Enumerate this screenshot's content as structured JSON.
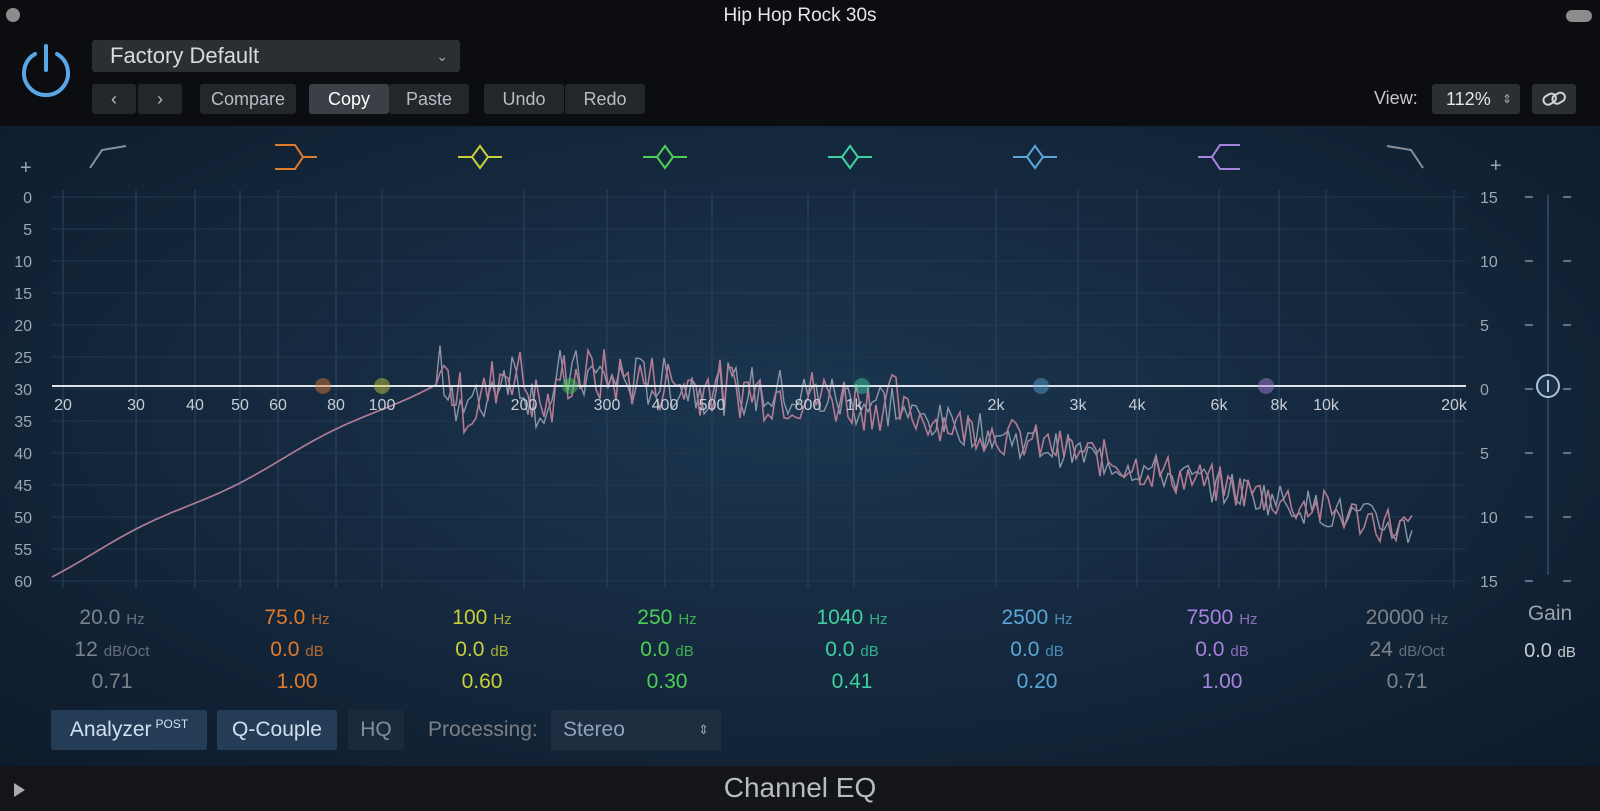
{
  "window": {
    "title": "Hip Hop Rock 30s"
  },
  "header": {
    "preset": "Factory Default",
    "buttons": {
      "prev": "‹",
      "next": "›",
      "compare": "Compare",
      "copy": "Copy",
      "paste": "Paste",
      "undo": "Undo",
      "redo": "Redo"
    },
    "view_label": "View:",
    "view_value": "112%"
  },
  "graph": {
    "left_scale": [
      "0",
      "5",
      "10",
      "15",
      "20",
      "25",
      "30",
      "35",
      "40",
      "45",
      "50",
      "55",
      "60"
    ],
    "right_scale": [
      "15",
      "10",
      "5",
      "0",
      "5",
      "10",
      "15"
    ],
    "freq_labels": [
      "20",
      "30",
      "40",
      "50",
      "60",
      "80",
      "100",
      "200",
      "300",
      "400",
      "500",
      "800",
      "1k",
      "2k",
      "3k",
      "4k",
      "6k",
      "8k",
      "10k",
      "20k"
    ],
    "plus_left": "+",
    "plus_right": "+"
  },
  "bands": [
    {
      "freq": "20.0",
      "freq_unit": "Hz",
      "gain": "12",
      "gain_unit": "dB/Oct",
      "q": "0.71",
      "color": "#8a8f98"
    },
    {
      "freq": "75.0",
      "freq_unit": "Hz",
      "gain": "0.0",
      "gain_unit": "dB",
      "q": "1.00",
      "color": "#e07b2c"
    },
    {
      "freq": "100",
      "freq_unit": "Hz",
      "gain": "0.0",
      "gain_unit": "dB",
      "q": "0.60",
      "color": "#c9cf37"
    },
    {
      "freq": "250",
      "freq_unit": "Hz",
      "gain": "0.0",
      "gain_unit": "dB",
      "q": "0.30",
      "color": "#4ccf55"
    },
    {
      "freq": "1040",
      "freq_unit": "Hz",
      "gain": "0.0",
      "gain_unit": "dB",
      "q": "0.41",
      "color": "#3fd0a0"
    },
    {
      "freq": "2500",
      "freq_unit": "Hz",
      "gain": "0.0",
      "gain_unit": "dB",
      "q": "0.20",
      "color": "#5aa6d6"
    },
    {
      "freq": "7500",
      "freq_unit": "Hz",
      "gain": "0.0",
      "gain_unit": "dB",
      "q": "1.00",
      "color": "#a883dd"
    },
    {
      "freq": "20000",
      "freq_unit": "Hz",
      "gain": "24",
      "gain_unit": "dB/Oct",
      "q": "0.71",
      "color": "#8a8f98"
    }
  ],
  "gain": {
    "label": "Gain",
    "value": "0.0",
    "unit": "dB"
  },
  "controls": {
    "analyzer": "Analyzer",
    "analyzer_sup": "POST",
    "qcouple": "Q-Couple",
    "hq": "HQ",
    "processing_label": "Processing:",
    "processing_value": "Stereo"
  },
  "footer": {
    "title": "Channel EQ"
  }
}
